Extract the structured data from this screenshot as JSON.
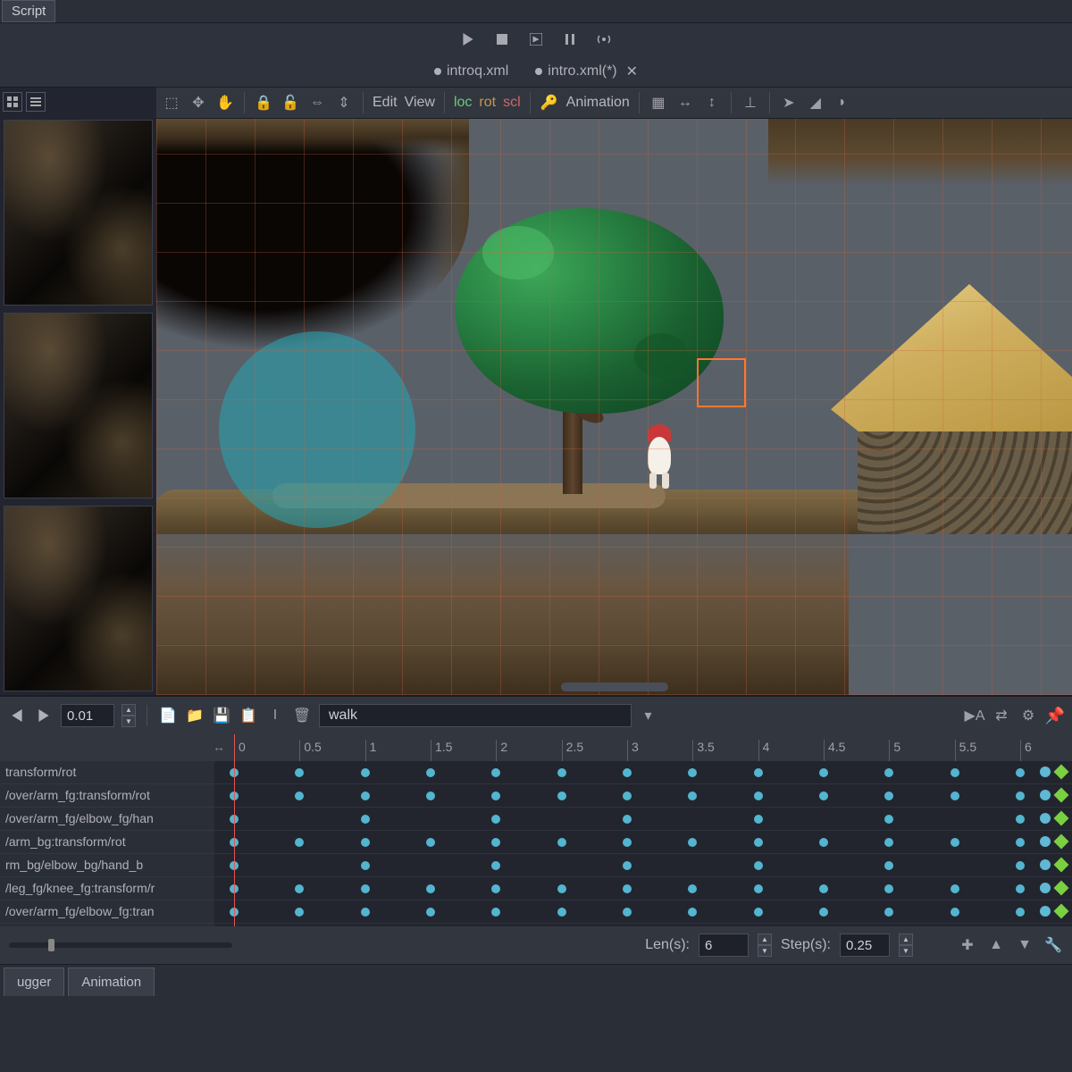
{
  "top": {
    "script": "Script"
  },
  "doc_tabs": [
    {
      "label": "introq.xml",
      "modified": false
    },
    {
      "label": "intro.xml(*)",
      "modified": true
    }
  ],
  "toolbar": {
    "edit": "Edit",
    "view": "View",
    "loc": "loc",
    "rot": "rot",
    "scl": "scl",
    "animation": "Animation"
  },
  "anim": {
    "time": "0.01",
    "name": "walk",
    "ruler": [
      "0",
      "0.5",
      "1",
      "1.5",
      "2",
      "2.5",
      "3",
      "3.5",
      "4",
      "4.5",
      "5",
      "5.5",
      "6"
    ],
    "tracks": [
      "transform/rot",
      "/over/arm_fg:transform/rot",
      "/over/arm_fg/elbow_fg/han",
      "/arm_bg:transform/rot",
      "rm_bg/elbow_bg/hand_b",
      "/leg_fg/knee_fg:transform/r",
      "/over/arm_fg/elbow_fg:tran"
    ],
    "keyframes": {
      "0": [
        0,
        0.5,
        1,
        1.5,
        2,
        2.5,
        3,
        3.5,
        4,
        4.5,
        5,
        5.5,
        6
      ],
      "1": [
        0,
        0.5,
        1,
        1.5,
        2,
        2.5,
        3,
        3.5,
        4,
        4.5,
        5,
        5.5,
        6
      ],
      "2": [
        0,
        1,
        2,
        3,
        4,
        5,
        6
      ],
      "3": [
        0,
        0.5,
        1,
        1.5,
        2,
        2.5,
        3,
        3.5,
        4,
        4.5,
        5,
        5.5,
        6
      ],
      "4": [
        0,
        1,
        2,
        3,
        4,
        5,
        6
      ],
      "5": [
        0,
        0.5,
        1,
        1.5,
        2,
        2.5,
        3,
        3.5,
        4,
        4.5,
        5,
        5.5,
        6
      ],
      "6": [
        0,
        0.5,
        1,
        1.5,
        2,
        2.5,
        3,
        3.5,
        4,
        4.5,
        5,
        5.5,
        6
      ]
    },
    "len_label": "Len(s):",
    "len_value": "6",
    "step_label": "Step(s):",
    "step_value": "0.25"
  },
  "bottom_tabs": [
    "ugger",
    "Animation"
  ]
}
